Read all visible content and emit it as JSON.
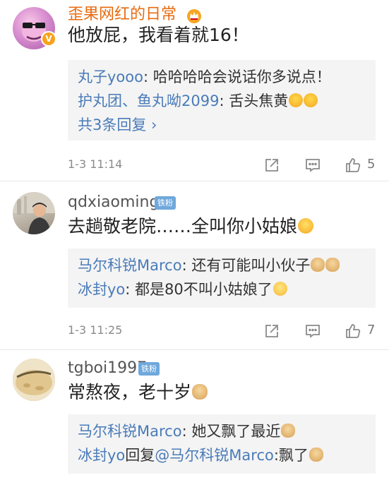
{
  "comments": [
    {
      "username": "歪果网红的日常",
      "content": "他放屁，我看着就16！",
      "replies": [
        {
          "name": "丸子yooo",
          "sep": ": ",
          "text": "哈哈哈哈会说话你多说点！"
        },
        {
          "name": "护丸团、鱼丸呦2099",
          "sep": ": ",
          "text": "舌头焦黄"
        }
      ],
      "more": "共3条回复 ›",
      "time": "1-3 11:14",
      "likes": "5",
      "verified_icon": "v-verified-icon",
      "crown_icon": "crown-icon"
    },
    {
      "username": "qdxiaoming",
      "badge": "铁粉",
      "content": "去趟敬老院……全叫你小姑娘",
      "replies": [
        {
          "name": "马尔科锐Marco",
          "sep": ": ",
          "text": "还有可能叫小伙子"
        },
        {
          "name": "冰封yo",
          "sep": ": ",
          "text": "都是80不叫小姑娘了"
        }
      ],
      "time": "1-3 11:25",
      "likes": "7"
    },
    {
      "username": "tgboi1997",
      "badge": "铁粉",
      "content": "常熬夜，老十岁",
      "replies": [
        {
          "name": "马尔科锐Marco",
          "sep": ": ",
          "text": "她又飘了最近"
        },
        {
          "name": "冰封yo",
          "reply_word": "回复",
          "mention": "@马尔科锐Marco",
          "sep": ":",
          "text": "飘了"
        }
      ]
    }
  ],
  "colors": {
    "username_orange": "#e86b0f",
    "link_blue": "#4a7bb8",
    "fan_badge": "#6fa8dc"
  }
}
